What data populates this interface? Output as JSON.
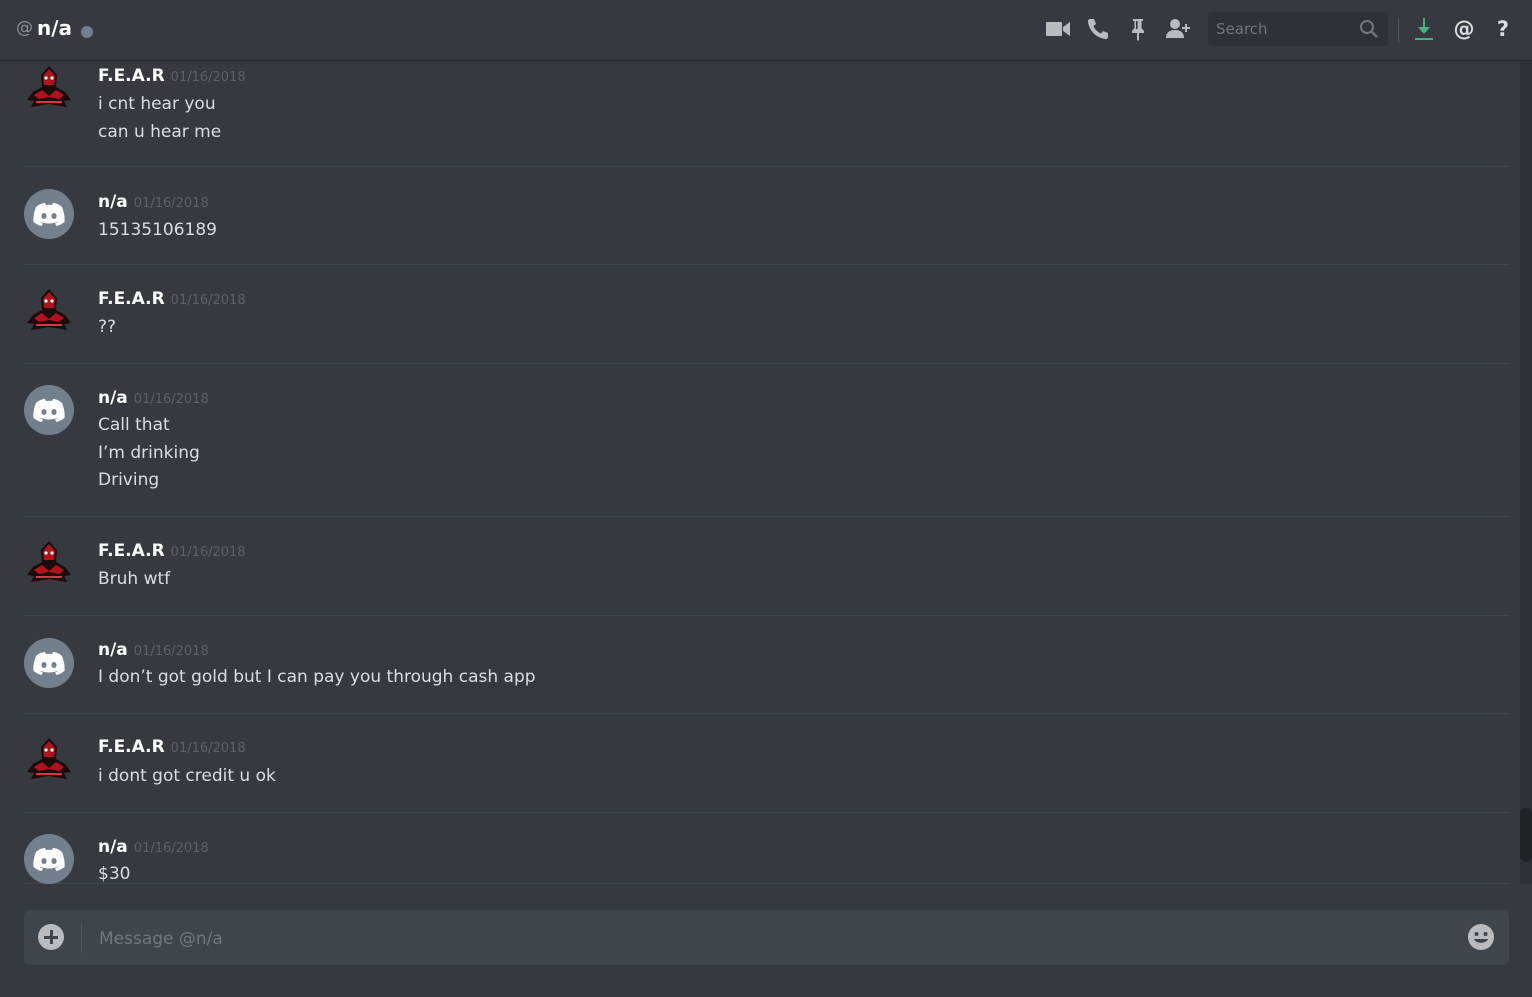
{
  "header": {
    "at_symbol": "@",
    "title": "n/a",
    "search_placeholder": "Search",
    "icons": [
      "video-camera-icon",
      "phone-icon",
      "pin-icon",
      "add-friend-icon",
      "search-icon",
      "download-icon",
      "mention-icon",
      "help-icon"
    ]
  },
  "messages": [
    {
      "author": "F.E.A.R",
      "timestamp": "01/16/2018",
      "avatar": "fear-avatar",
      "lines": [
        "i cnt hear you",
        "can u hear me"
      ]
    },
    {
      "author": "n/a",
      "timestamp": "01/16/2018",
      "avatar": "discord-avatar",
      "lines": [
        "15135106189"
      ]
    },
    {
      "author": "F.E.A.R",
      "timestamp": "01/16/2018",
      "avatar": "fear-avatar",
      "lines": [
        "??"
      ]
    },
    {
      "author": "n/a",
      "timestamp": "01/16/2018",
      "avatar": "discord-avatar",
      "lines": [
        "Call that",
        "I’m drinking",
        "Driving"
      ]
    },
    {
      "author": "F.E.A.R",
      "timestamp": "01/16/2018",
      "avatar": "fear-avatar",
      "lines": [
        "Bruh wtf"
      ]
    },
    {
      "author": "n/a",
      "timestamp": "01/16/2018",
      "avatar": "discord-avatar",
      "lines": [
        "I don’t got gold but I can pay you through cash app"
      ]
    },
    {
      "author": "F.E.A.R",
      "timestamp": "01/16/2018",
      "avatar": "fear-avatar",
      "lines": [
        "i dont got credit u ok"
      ]
    },
    {
      "author": "n/a",
      "timestamp": "01/16/2018",
      "avatar": "discord-avatar",
      "lines": [
        "$30"
      ]
    }
  ],
  "composer": {
    "placeholder": "Message @n/a"
  },
  "colors": {
    "background": "#36393f",
    "composer": "#40444b",
    "status_offline": "#747f8d",
    "download_accent": "#43b581",
    "fear_avatar_red": "#b3121b"
  }
}
